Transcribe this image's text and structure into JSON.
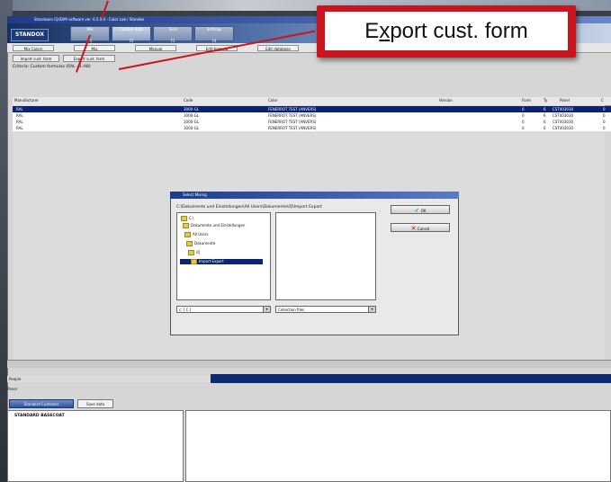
{
  "window": {
    "title": "Standowin iQ/iDIM software ver. 6.5.0.0 - Color Lab / Standox",
    "brand": "STANDOX"
  },
  "main_tabs": [
    {
      "label": "Mix",
      "sub": "F1"
    },
    {
      "label": "Custom data",
      "sub": "F2"
    },
    {
      "label": "Tools",
      "sub": "F3"
    },
    {
      "label": "Settings",
      "sub": "F4"
    }
  ],
  "nav_buttons": [
    "Mix Colors",
    "Mix",
    "Manual",
    "Edit formula",
    "Edit database"
  ],
  "action_buttons": {
    "import": "Import cust. form",
    "export": "Export cust. form"
  },
  "criteria": "Criteria: Custom formulas (RAL - 1-H8)",
  "table": {
    "headers": [
      "Manufacturer",
      "Code",
      "Color",
      "Version",
      "Form",
      "Ty",
      "Panel",
      "C"
    ],
    "rows": [
      [
        "RAL",
        "3000-GL",
        "FENERROT TEST (ANVERS)",
        "",
        "0",
        "6",
        "CST403030",
        "0"
      ],
      [
        "RAL",
        "3000-GL",
        "FENERROT TEST (ANVERS)",
        "",
        "0",
        "6",
        "CST403030",
        "0"
      ],
      [
        "RAL",
        "3000-GL",
        "FENERROT TEST (ANVERS)",
        "",
        "0",
        "6",
        "CST403030",
        "0"
      ],
      [
        "RAL",
        "3000-GL",
        "FENERROT TEST (ANVERS)",
        "",
        "0",
        "6",
        "CST403030",
        "0"
      ]
    ]
  },
  "dialog": {
    "title": "Select Mixing",
    "path": "C:\\Dokumente und Einstellungen\\All Users\\Dokumente\\iQ\\Import Export",
    "tree": [
      "C:\\",
      "Dokumente und Einstellungen",
      "All Users",
      "Dokumente",
      "iQ",
      "Import Export"
    ],
    "selected_tree_index": 5,
    "drive": "c: [ C ]",
    "filter": "Collection files",
    "ok_label": "OK",
    "cancel_label": "Cancel"
  },
  "bottom": {
    "people_label": "People",
    "panel_label": "Panel",
    "standard_button": "Standard Customer",
    "save_button": "Save data",
    "standard_header": "STANDARD BASECOAT"
  },
  "callout": {
    "prefix": "E",
    "underlined": "x",
    "suffix": "port cust. form"
  },
  "colors": {
    "brand_blue": "#16305f",
    "selection": "#0a2472",
    "callout_red": "#c8161e"
  }
}
